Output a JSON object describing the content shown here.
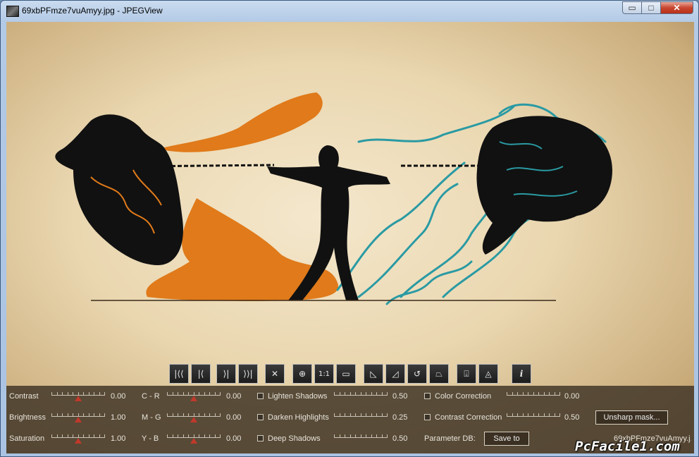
{
  "window": {
    "title": "69xbPFmze7vuAmyy.jpg - JPEGView",
    "min_symbol": "▭",
    "max_symbol": "□",
    "close_symbol": "✕"
  },
  "toolbar": {
    "buttons": [
      {
        "icon": "first-image-icon",
        "glyph": "|⟨⟨"
      },
      {
        "icon": "previous-image-icon",
        "glyph": "|⟨"
      },
      {
        "icon": "next-image-icon",
        "glyph": "⟩|"
      },
      {
        "icon": "last-image-icon",
        "glyph": "⟩⟩|"
      },
      {
        "icon": "close-image-icon",
        "glyph": "✕"
      },
      {
        "icon": "zoom-icon",
        "glyph": "⊕"
      },
      {
        "icon": "actual-size-icon",
        "glyph": "1:1"
      },
      {
        "icon": "fit-window-icon",
        "glyph": "▭"
      },
      {
        "icon": "rotate-left-icon",
        "glyph": "◺"
      },
      {
        "icon": "rotate-right-icon",
        "glyph": "◿"
      },
      {
        "icon": "rotate-free-icon",
        "glyph": "↺"
      },
      {
        "icon": "perspective-icon",
        "glyph": "⏢"
      },
      {
        "icon": "keep-params-icon",
        "glyph": "⍗"
      },
      {
        "icon": "landscape-mode-icon",
        "glyph": "◬"
      },
      {
        "icon": "info-icon",
        "glyph": "i"
      }
    ]
  },
  "panel": {
    "sliders_left": [
      {
        "label": "Contrast",
        "value": "0.00",
        "level": 0.5
      },
      {
        "label": "Brightness",
        "value": "1.00",
        "level": 0.5
      },
      {
        "label": "Saturation",
        "value": "1.00",
        "level": 0.5
      }
    ],
    "sliders_color": [
      {
        "label": "C - R",
        "value": "0.00",
        "level": 0.5
      },
      {
        "label": "M - G",
        "value": "0.00",
        "level": 0.5
      },
      {
        "label": "Y - B",
        "value": "0.00",
        "level": 0.5
      }
    ],
    "checks_mid": [
      {
        "label": "Lighten Shadows",
        "value": "0.50",
        "checked": false
      },
      {
        "label": "Darken Highlights",
        "value": "0.25",
        "checked": false
      },
      {
        "label": "Deep Shadows",
        "value": "0.50",
        "checked": false
      }
    ],
    "checks_right": [
      {
        "label": "Color Correction",
        "value": "0.00",
        "checked": false
      },
      {
        "label": "Contrast Correction",
        "value": "0.50",
        "checked": false
      }
    ],
    "unsharp_label": "Unsharp mask...",
    "param_db_label": "Parameter DB:",
    "save_label": "Save to",
    "file_name": "69xbPFmze7vuAmyy.j..."
  },
  "watermark": "PcFacile1.com",
  "colors": {
    "accent_orange": "#e07a1a",
    "accent_teal": "#2a9aa3",
    "silhouette": "#111111"
  }
}
